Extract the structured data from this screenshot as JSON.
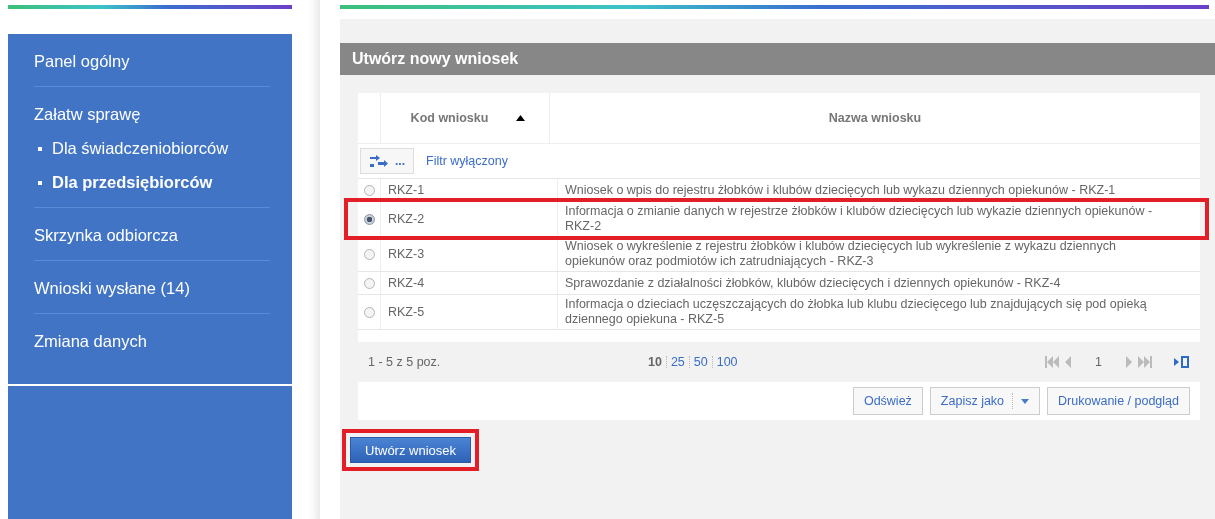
{
  "sidebar": {
    "items": [
      {
        "label": "Panel ogólny",
        "selected": false
      },
      {
        "label": "Załatw sprawę",
        "selected": false,
        "children": [
          {
            "label": "Dla świadczeniobiorców",
            "selected": false
          },
          {
            "label": "Dla przedsiębiorców",
            "selected": true
          }
        ]
      },
      {
        "label": "Skrzynka odbiorcza",
        "selected": false
      },
      {
        "label": "Wnioski wysłane (14)",
        "selected": false
      },
      {
        "label": "Zmiana danych",
        "selected": false
      }
    ]
  },
  "panel": {
    "title": "Utwórz nowy wniosek",
    "table": {
      "columns": [
        {
          "label": "Kod wniosku",
          "sorted": true
        },
        {
          "label": "Nazwa wniosku",
          "sorted": false
        }
      ],
      "filter_button": "...",
      "filter_status": "Filtr wyłączony",
      "rows": [
        {
          "code": "RKZ-1",
          "name": "Wniosek o wpis do rejestru żłobków i klubów dziecięcych lub wykazu dziennych opiekunów - RKZ-1",
          "selected": false,
          "highlighted": false
        },
        {
          "code": "RKZ-2",
          "name": "Informacja o zmianie danych w rejestrze żłobków i klubów dziecięcych lub wykazie dziennych opiekunów - RKZ-2",
          "selected": true,
          "highlighted": true
        },
        {
          "code": "RKZ-3",
          "name": "Wniosek o wykreślenie z rejestru żłobków i klubów dziecięcych lub wykreślenie z wykazu dziennych opiekunów oraz podmiotów ich zatrudniających - RKZ-3",
          "selected": false,
          "highlighted": false
        },
        {
          "code": "RKZ-4",
          "name": "Sprawozdanie z działalności żłobków, klubów dziecięcych i dziennych opiekunów - RKZ-4",
          "selected": false,
          "highlighted": false
        },
        {
          "code": "RKZ-5",
          "name": "Informacja o dzieciach uczęszczających do żłobka lub klubu dziecięcego lub znajdujących się pod opieką dziennego opiekuna - RKZ-5",
          "selected": false,
          "highlighted": false
        }
      ],
      "range": "1 - 5 z 5 poz.",
      "page_sizes": [
        {
          "label": "10",
          "selected": true
        },
        {
          "label": "25",
          "selected": false
        },
        {
          "label": "50",
          "selected": false
        },
        {
          "label": "100",
          "selected": false
        }
      ],
      "page": "1",
      "actions": [
        {
          "label": "Odśwież",
          "kind": "plain"
        },
        {
          "label": "Zapisz jako",
          "kind": "dropdown"
        },
        {
          "label": "Drukowanie / podgląd",
          "kind": "plain"
        }
      ]
    },
    "create_button": {
      "label": "Utwórz wniosek",
      "highlighted": true
    }
  }
}
